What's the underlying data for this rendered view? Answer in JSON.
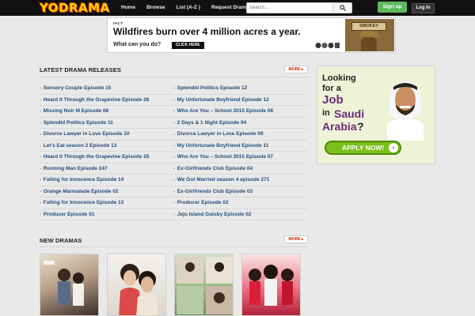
{
  "header": {
    "logo": "YODRAMA",
    "nav": [
      "Home",
      "Browse",
      "List (A-Z )",
      "Request Drama"
    ],
    "search_placeholder": "Search...",
    "signup": "Sign up",
    "login": "Log In"
  },
  "banner_ad": {
    "fact_label": "FACT:",
    "headline": "Wildfires burn over 4 million acres a year.",
    "question": "What can you do?",
    "cta": "CLICK HERE",
    "badge": "SMOKEY"
  },
  "latest": {
    "title": "LATEST DRAMA RELEASES",
    "more": "MORE",
    "left": [
      "Sensory Couple Episode 15",
      "Heard It Through the Grapevine Episode 26",
      "Missing Noir M Episode 08",
      "Splendid Politics Episode 11",
      "Divorce Lawyer in Love Episode 10",
      "Let's Eat season 2 Episode 13",
      "Heard It Through the Grapevine Episode 25",
      "Running Man Episode 247",
      "Falling for Innocence Episode 14",
      "Orange Marmalade Episode 02",
      "Falling for Innocence Episode 13",
      "Producer Episode 01"
    ],
    "right": [
      "Splendid Politics Episode 12",
      "My Unfortunate Boyfriend Episode 12",
      "Who Are You – School 2015 Episode 08",
      "2 Days & 1 Night Episode 94",
      "Divorce Lawyer in Love Episode 09",
      "My Unfortunate Boyfriend Episode 11",
      "Who Are You – School 2015 Episode 07",
      "Ex-Girlfriends Club Episode 04",
      "We Got Married season 4 episode 271",
      "Ex-Girlfriends Club Episode 03",
      "Producer Episode 02",
      "Jeju Island Gatsby Episode 02"
    ]
  },
  "job_ad": {
    "line1": "Looking",
    "line2": "for a",
    "job": "Job",
    "in": "in",
    "saudi": "Saudi",
    "arabia": "Arabia",
    "q": "?",
    "apply": "APPLY NOW!"
  },
  "new_dramas": {
    "title": "NEW DRAMAS",
    "more": "MORE",
    "posters": [
      "poster-1",
      "poster-2",
      "poster-3",
      "poster-4"
    ]
  },
  "colors": {
    "accent": "#cc2200",
    "link": "#1f4c7a",
    "signup": "#5cb85c"
  }
}
